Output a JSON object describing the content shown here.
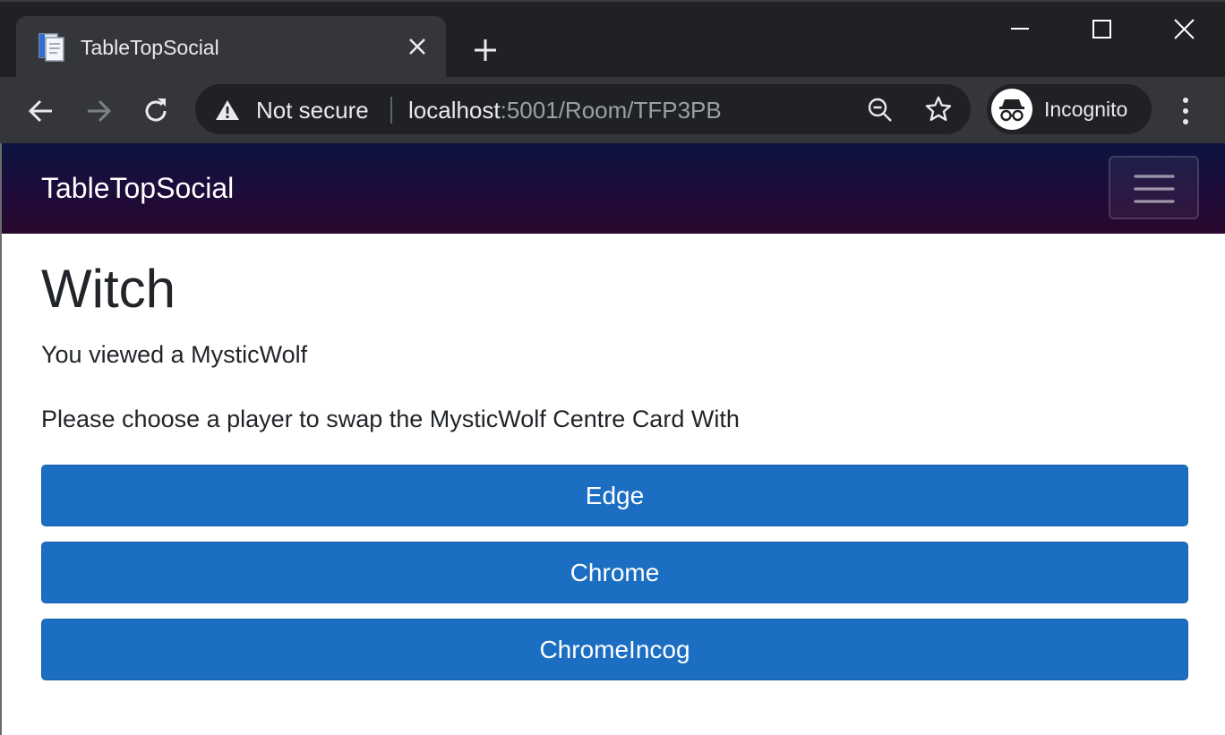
{
  "browser": {
    "tab_title": "TableTopSocial",
    "security_label": "Not secure",
    "url_host": "localhost",
    "url_rest": ":5001/Room/TFP3PB",
    "profile_label": "Incognito",
    "icons": [
      "document-favicon-icon",
      "close-icon",
      "plus-icon",
      "minimize-icon",
      "maximize-icon",
      "window-close-icon",
      "back-arrow-icon",
      "forward-arrow-icon",
      "reload-icon",
      "warning-icon",
      "zoom-out-icon",
      "star-icon",
      "incognito-icon",
      "more-vert-icon"
    ]
  },
  "navbar": {
    "brand": "TableTopSocial",
    "toggler_icon": "hamburger-menu-icon"
  },
  "main": {
    "title": "Witch",
    "viewed_text": "You viewed a MysticWolf",
    "prompt_text": "Please choose a player to swap the MysticWolf Centre Card With",
    "players": [
      {
        "label": "Edge"
      },
      {
        "label": "Chrome"
      },
      {
        "label": "ChromeIncog"
      }
    ]
  },
  "colors": {
    "button_primary": "#1b6ec2",
    "navbar_top": "#0b1440",
    "navbar_bottom": "#28082c",
    "chrome_frame": "#202124",
    "chrome_toolbar": "#35363a"
  }
}
